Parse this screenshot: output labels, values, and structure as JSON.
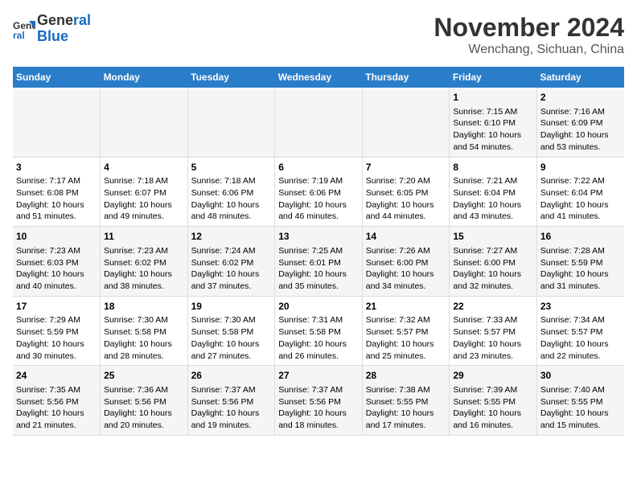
{
  "header": {
    "logo_line1": "General",
    "logo_line2": "Blue",
    "title": "November 2024",
    "subtitle": "Wenchang, Sichuan, China"
  },
  "weekdays": [
    "Sunday",
    "Monday",
    "Tuesday",
    "Wednesday",
    "Thursday",
    "Friday",
    "Saturday"
  ],
  "weeks": [
    [
      {
        "day": "",
        "info": ""
      },
      {
        "day": "",
        "info": ""
      },
      {
        "day": "",
        "info": ""
      },
      {
        "day": "",
        "info": ""
      },
      {
        "day": "",
        "info": ""
      },
      {
        "day": "1",
        "info": "Sunrise: 7:15 AM\nSunset: 6:10 PM\nDaylight: 10 hours\nand 54 minutes."
      },
      {
        "day": "2",
        "info": "Sunrise: 7:16 AM\nSunset: 6:09 PM\nDaylight: 10 hours\nand 53 minutes."
      }
    ],
    [
      {
        "day": "3",
        "info": "Sunrise: 7:17 AM\nSunset: 6:08 PM\nDaylight: 10 hours\nand 51 minutes."
      },
      {
        "day": "4",
        "info": "Sunrise: 7:18 AM\nSunset: 6:07 PM\nDaylight: 10 hours\nand 49 minutes."
      },
      {
        "day": "5",
        "info": "Sunrise: 7:18 AM\nSunset: 6:06 PM\nDaylight: 10 hours\nand 48 minutes."
      },
      {
        "day": "6",
        "info": "Sunrise: 7:19 AM\nSunset: 6:06 PM\nDaylight: 10 hours\nand 46 minutes."
      },
      {
        "day": "7",
        "info": "Sunrise: 7:20 AM\nSunset: 6:05 PM\nDaylight: 10 hours\nand 44 minutes."
      },
      {
        "day": "8",
        "info": "Sunrise: 7:21 AM\nSunset: 6:04 PM\nDaylight: 10 hours\nand 43 minutes."
      },
      {
        "day": "9",
        "info": "Sunrise: 7:22 AM\nSunset: 6:04 PM\nDaylight: 10 hours\nand 41 minutes."
      }
    ],
    [
      {
        "day": "10",
        "info": "Sunrise: 7:23 AM\nSunset: 6:03 PM\nDaylight: 10 hours\nand 40 minutes."
      },
      {
        "day": "11",
        "info": "Sunrise: 7:23 AM\nSunset: 6:02 PM\nDaylight: 10 hours\nand 38 minutes."
      },
      {
        "day": "12",
        "info": "Sunrise: 7:24 AM\nSunset: 6:02 PM\nDaylight: 10 hours\nand 37 minutes."
      },
      {
        "day": "13",
        "info": "Sunrise: 7:25 AM\nSunset: 6:01 PM\nDaylight: 10 hours\nand 35 minutes."
      },
      {
        "day": "14",
        "info": "Sunrise: 7:26 AM\nSunset: 6:00 PM\nDaylight: 10 hours\nand 34 minutes."
      },
      {
        "day": "15",
        "info": "Sunrise: 7:27 AM\nSunset: 6:00 PM\nDaylight: 10 hours\nand 32 minutes."
      },
      {
        "day": "16",
        "info": "Sunrise: 7:28 AM\nSunset: 5:59 PM\nDaylight: 10 hours\nand 31 minutes."
      }
    ],
    [
      {
        "day": "17",
        "info": "Sunrise: 7:29 AM\nSunset: 5:59 PM\nDaylight: 10 hours\nand 30 minutes."
      },
      {
        "day": "18",
        "info": "Sunrise: 7:30 AM\nSunset: 5:58 PM\nDaylight: 10 hours\nand 28 minutes."
      },
      {
        "day": "19",
        "info": "Sunrise: 7:30 AM\nSunset: 5:58 PM\nDaylight: 10 hours\nand 27 minutes."
      },
      {
        "day": "20",
        "info": "Sunrise: 7:31 AM\nSunset: 5:58 PM\nDaylight: 10 hours\nand 26 minutes."
      },
      {
        "day": "21",
        "info": "Sunrise: 7:32 AM\nSunset: 5:57 PM\nDaylight: 10 hours\nand 25 minutes."
      },
      {
        "day": "22",
        "info": "Sunrise: 7:33 AM\nSunset: 5:57 PM\nDaylight: 10 hours\nand 23 minutes."
      },
      {
        "day": "23",
        "info": "Sunrise: 7:34 AM\nSunset: 5:57 PM\nDaylight: 10 hours\nand 22 minutes."
      }
    ],
    [
      {
        "day": "24",
        "info": "Sunrise: 7:35 AM\nSunset: 5:56 PM\nDaylight: 10 hours\nand 21 minutes."
      },
      {
        "day": "25",
        "info": "Sunrise: 7:36 AM\nSunset: 5:56 PM\nDaylight: 10 hours\nand 20 minutes."
      },
      {
        "day": "26",
        "info": "Sunrise: 7:37 AM\nSunset: 5:56 PM\nDaylight: 10 hours\nand 19 minutes."
      },
      {
        "day": "27",
        "info": "Sunrise: 7:37 AM\nSunset: 5:56 PM\nDaylight: 10 hours\nand 18 minutes."
      },
      {
        "day": "28",
        "info": "Sunrise: 7:38 AM\nSunset: 5:55 PM\nDaylight: 10 hours\nand 17 minutes."
      },
      {
        "day": "29",
        "info": "Sunrise: 7:39 AM\nSunset: 5:55 PM\nDaylight: 10 hours\nand 16 minutes."
      },
      {
        "day": "30",
        "info": "Sunrise: 7:40 AM\nSunset: 5:55 PM\nDaylight: 10 hours\nand 15 minutes."
      }
    ]
  ]
}
